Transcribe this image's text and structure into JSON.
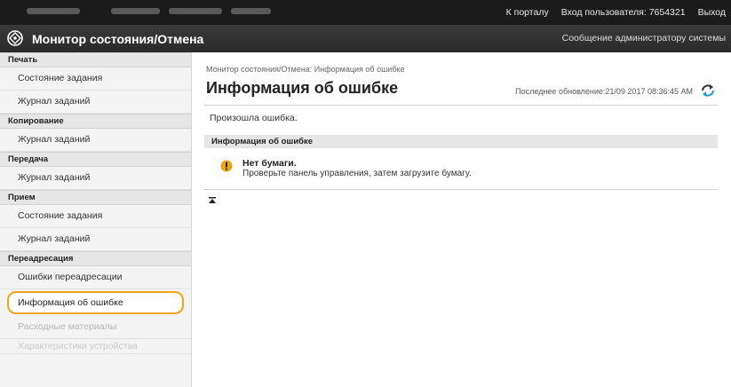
{
  "topbar": {
    "portal_link": "К порталу",
    "login_user": "Вход пользователя: 7654321",
    "logout_link": "Выход"
  },
  "titlebar": {
    "title": "Монитор состояния/Отмена",
    "admin_message_link": "Сообщение администратору системы"
  },
  "sidebar": {
    "print_header": "Печать",
    "print_items": [
      "Состояние задания",
      "Журнал заданий"
    ],
    "copy_header": "Копирование",
    "copy_items": [
      "Журнал заданий"
    ],
    "send_header": "Передача",
    "send_items": [
      "Журнал заданий"
    ],
    "receive_header": "Прием",
    "receive_items": [
      "Состояние задания",
      "Журнал заданий"
    ],
    "forward_header": "Переадресация",
    "forward_items": [
      "Ошибки переадресации"
    ],
    "error_info": "Информация об ошибке",
    "consumables": "Расходные материалы",
    "device_features": "Характеристики устройства"
  },
  "main": {
    "breadcrumb": "Монитор состояния/Отмена: Информация об ошибке",
    "title": "Информация об ошибке",
    "last_updated": "Последнее обновление:21/09 2017 08:36:45 AM",
    "error_occurred": "Произошла ошибка.",
    "section_title": "Информация об ошибке",
    "error_title": "Нет бумаги.",
    "error_description": "Проверьте панель управления, затем загрузите бумагу."
  },
  "colors": {
    "highlight": "#f0a21b",
    "warning_icon": "#e8a317",
    "topbar_bg": "#1b1b1b"
  }
}
